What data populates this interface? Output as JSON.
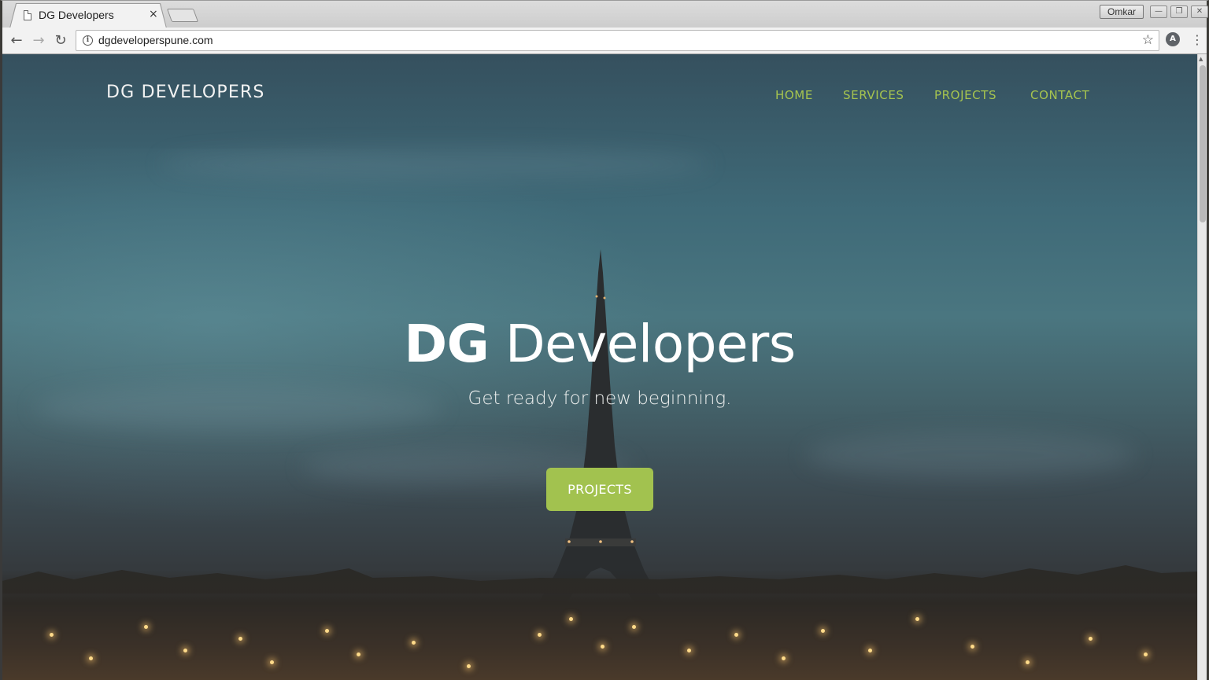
{
  "browser": {
    "tab_title": "DG Developers",
    "tab_close": "×",
    "user_label": "Omkar",
    "url": "dgdeveloperspune.com",
    "icons": {
      "back": "back-arrow-icon",
      "forward": "forward-arrow-icon",
      "reload": "reload-icon",
      "info": "info-icon",
      "bookmark": "star-icon",
      "extension": "extension-icon",
      "menu": "kebab-menu-icon"
    }
  },
  "site": {
    "brand": "DG DEVELOPERS",
    "nav": [
      "HOME",
      "SERVICES",
      "PROJECTS",
      "CONTACT"
    ],
    "hero": {
      "title_bold": "DG",
      "title_regular": "Developers",
      "subtitle": "Get ready for new beginning.",
      "cta_label": "PROJECTS"
    }
  },
  "colors": {
    "accent": "#a2c24f",
    "nav_link": "#a6c44f",
    "text_light": "#ffffff"
  }
}
